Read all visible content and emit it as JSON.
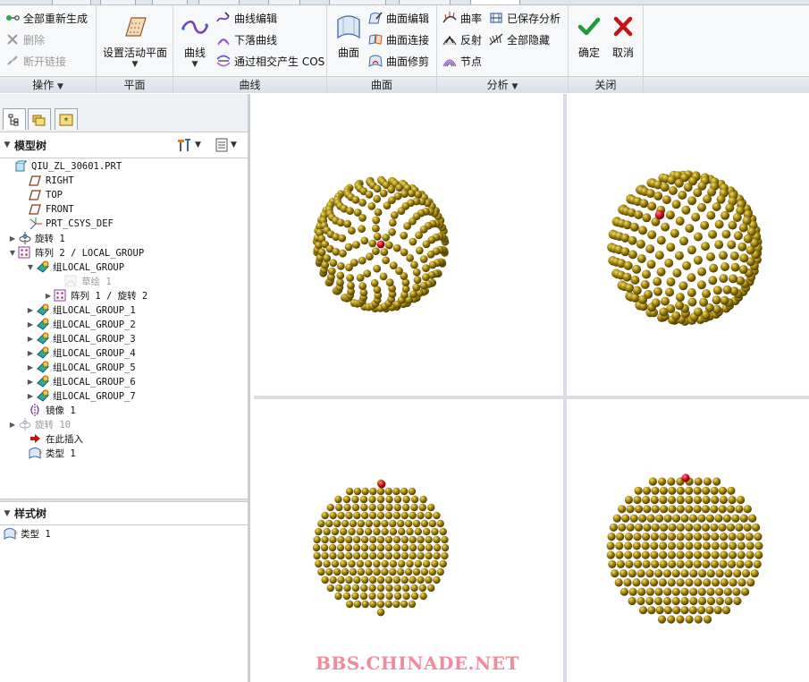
{
  "ribbon": {
    "groups": {
      "operations": {
        "label": "操作",
        "regenerate": "全部重新生成",
        "delete": "删除",
        "break_link": "断开链接"
      },
      "plane": {
        "label": "平面",
        "set_active_plane": "设置活动平面"
      },
      "curve": {
        "label": "曲线",
        "curve": "曲线",
        "curve_edit": "曲线编辑",
        "drop_curve": "下落曲线",
        "intersect_cos": "通过相交产生 COS"
      },
      "surface": {
        "label": "曲面",
        "surface": "曲面",
        "surface_edit": "曲面编辑",
        "surface_connect": "曲面连接",
        "surface_trim": "曲面修剪"
      },
      "analysis": {
        "label": "分析",
        "curvature": "曲率",
        "saved_analysis": "已保存分析",
        "reflection": "反射",
        "hide_all": "全部隐藏",
        "nodes": "节点"
      },
      "close": {
        "label": "关闭",
        "ok": "确定",
        "cancel": "取消"
      }
    }
  },
  "model_tree": {
    "title": "模型树",
    "items": [
      {
        "label": "QIU_ZL_30601.PRT",
        "icon": "part-icon",
        "expander": "",
        "dim": false
      },
      {
        "label": "RIGHT",
        "icon": "datum-plane-icon",
        "expander": "",
        "dim": false
      },
      {
        "label": "TOP",
        "icon": "datum-plane-icon",
        "expander": "",
        "dim": false
      },
      {
        "label": "FRONT",
        "icon": "datum-plane-icon",
        "expander": "",
        "dim": false
      },
      {
        "label": "PRT_CSYS_DEF",
        "icon": "csys-icon",
        "expander": "",
        "dim": false
      },
      {
        "label": "旋转 1",
        "icon": "revolve-icon",
        "expander": "▶",
        "dim": false
      },
      {
        "label": "阵列 2 / LOCAL_GROUP",
        "icon": "pattern-icon",
        "expander": "▼",
        "dim": false
      },
      {
        "label": "组LOCAL_GROUP",
        "icon": "group-icon",
        "expander": "▼",
        "dim": false
      },
      {
        "label": "草绘 1",
        "icon": "sketch-icon",
        "expander": "",
        "dim": true
      },
      {
        "label": "阵列 1 / 旋转 2",
        "icon": "pattern-icon",
        "expander": "▶",
        "dim": false
      },
      {
        "label": "组LOCAL_GROUP_1",
        "icon": "group-icon",
        "expander": "▶",
        "dim": false
      },
      {
        "label": "组LOCAL_GROUP_2",
        "icon": "group-icon",
        "expander": "▶",
        "dim": false
      },
      {
        "label": "组LOCAL_GROUP_3",
        "icon": "group-icon",
        "expander": "▶",
        "dim": false
      },
      {
        "label": "组LOCAL_GROUP_4",
        "icon": "group-icon",
        "expander": "▶",
        "dim": false
      },
      {
        "label": "组LOCAL_GROUP_5",
        "icon": "group-icon",
        "expander": "▶",
        "dim": false
      },
      {
        "label": "组LOCAL_GROUP_6",
        "icon": "group-icon",
        "expander": "▶",
        "dim": false
      },
      {
        "label": "组LOCAL_GROUP_7",
        "icon": "group-icon",
        "expander": "▶",
        "dim": false
      },
      {
        "label": "镜像 1",
        "icon": "mirror-icon",
        "expander": "",
        "dim": false
      },
      {
        "label": "旋转 10",
        "icon": "revolve-icon",
        "expander": "▶",
        "dim": true
      },
      {
        "label": "在此插入",
        "icon": "insert-here-icon",
        "expander": "",
        "dim": false
      },
      {
        "label": "类型 1",
        "icon": "style-icon",
        "expander": "",
        "dim": false
      }
    ]
  },
  "style_tree": {
    "title": "样式树",
    "items": [
      {
        "label": "类型 1",
        "icon": "style-icon"
      }
    ]
  },
  "viewport": {
    "watermark": "BBS.CHINADE.NET",
    "sphere_color": "#9a7d0a",
    "highlight_color": "#d0021b"
  }
}
